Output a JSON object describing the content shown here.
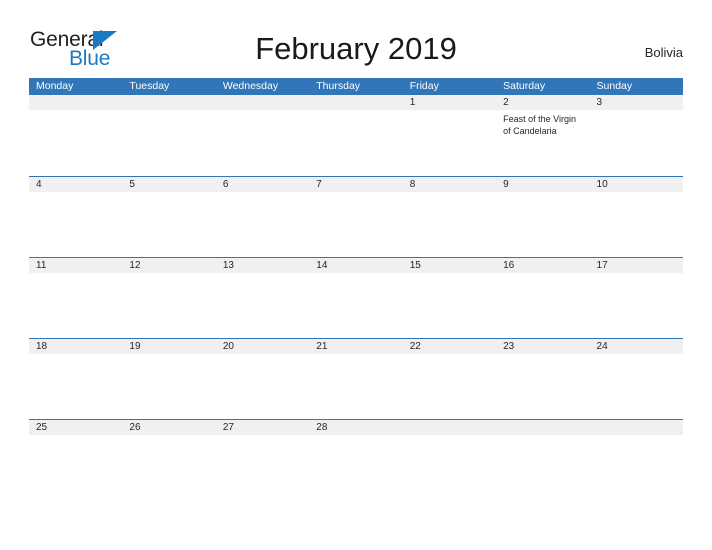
{
  "brand": {
    "name_line1": "General",
    "name_line2": "Blue",
    "triangle_icon": "triangle-right-icon",
    "color_dark": "#231f20",
    "color_blue": "#1b7ac4"
  },
  "header": {
    "title": "February 2019",
    "month": "February",
    "year": "2019",
    "locale": "Bolivia"
  },
  "theme": {
    "header_blue": "#3076b8",
    "row_band_gray": "#f0f0f0",
    "text": "#262626",
    "page_background": "#ffffff"
  },
  "calendar": {
    "weekdays": [
      "Monday",
      "Tuesday",
      "Wednesday",
      "Thursday",
      "Friday",
      "Saturday",
      "Sunday"
    ],
    "weeks": [
      [
        {
          "day": "",
          "events": []
        },
        {
          "day": "",
          "events": []
        },
        {
          "day": "",
          "events": []
        },
        {
          "day": "",
          "events": []
        },
        {
          "day": "1",
          "events": []
        },
        {
          "day": "2",
          "events": [
            "Feast of the Virgin of Candelaria"
          ]
        },
        {
          "day": "3",
          "events": []
        }
      ],
      [
        {
          "day": "4",
          "events": []
        },
        {
          "day": "5",
          "events": []
        },
        {
          "day": "6",
          "events": []
        },
        {
          "day": "7",
          "events": []
        },
        {
          "day": "8",
          "events": []
        },
        {
          "day": "9",
          "events": []
        },
        {
          "day": "10",
          "events": []
        }
      ],
      [
        {
          "day": "11",
          "events": []
        },
        {
          "day": "12",
          "events": []
        },
        {
          "day": "13",
          "events": []
        },
        {
          "day": "14",
          "events": []
        },
        {
          "day": "15",
          "events": []
        },
        {
          "day": "16",
          "events": []
        },
        {
          "day": "17",
          "events": []
        }
      ],
      [
        {
          "day": "18",
          "events": []
        },
        {
          "day": "19",
          "events": []
        },
        {
          "day": "20",
          "events": []
        },
        {
          "day": "21",
          "events": []
        },
        {
          "day": "22",
          "events": []
        },
        {
          "day": "23",
          "events": []
        },
        {
          "day": "24",
          "events": []
        }
      ],
      [
        {
          "day": "25",
          "events": []
        },
        {
          "day": "26",
          "events": []
        },
        {
          "day": "27",
          "events": []
        },
        {
          "day": "28",
          "events": []
        },
        {
          "day": "",
          "events": []
        },
        {
          "day": "",
          "events": []
        },
        {
          "day": "",
          "events": []
        }
      ]
    ]
  }
}
